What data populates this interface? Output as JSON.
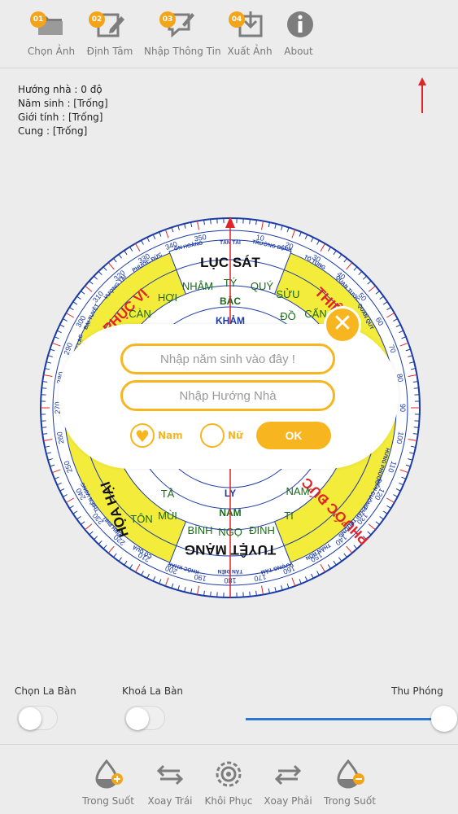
{
  "toolbar": {
    "items": [
      {
        "badge": "01",
        "label": "Chọn Ảnh"
      },
      {
        "badge": "02",
        "label": "Định Tâm"
      },
      {
        "badge": "03",
        "label": "Nhập Thông Tin"
      },
      {
        "badge": "04",
        "label": "Xuất Ảnh"
      },
      {
        "badge": "",
        "label": "About"
      }
    ]
  },
  "info": {
    "house_direction": "Hướng nhà : 0 độ",
    "birth_year": "Năm sinh : [Trống]",
    "gender": "Giới tính : [Trống]",
    "cung": "Cung : [Trống]"
  },
  "compass": {
    "heading_degree": 0,
    "degree_labels": [
      "350",
      "340",
      "330",
      "320",
      "310",
      "300",
      "290",
      "280",
      "270",
      "260",
      "250",
      "240",
      "230",
      "220",
      "210",
      "200",
      "190",
      "180",
      "170",
      "160",
      "150",
      "140",
      "130",
      "120",
      "110",
      "100",
      "90",
      "80",
      "70",
      "60",
      "50",
      "40",
      "30",
      "20",
      "10"
    ],
    "section_names": {
      "top": "LỤC SÁT",
      "left_upper": "PHỤC VỊ",
      "right_upper": "THIÊN",
      "left_lower": "HỌA HẠI",
      "right_lower": "PHƯỚC ĐỨC",
      "bottom": "TUYỆT MẠNG"
    },
    "sectors": {
      "top_left": "NHÂM",
      "top_mid": "TÝ",
      "top_right": "QUÝ",
      "trigram_top": "BẮC",
      "trigram_top2": "KHẢM",
      "upper_right": "SỬU",
      "upper_right2": "ĐỒ",
      "upper_right3": "CẤN",
      "upper_left": "HỢI",
      "upper_left2": "CÀN",
      "lower_left": "TÔN",
      "lower_left2": "MÙI",
      "lower_left3": "TÂ",
      "bottom_left": "BÍNH",
      "bottom_mid": "NGỌ",
      "bottom_right": "ĐINH",
      "trigram_bottom": "NAM",
      "trigram_bottom2": "LY",
      "lower_right": "TI",
      "lower_right2": "NAM"
    },
    "star_labels": {
      "s1": "TẤN TÀI",
      "s2": "TRƯỜNG BỆNH",
      "s3": "ÔN HOÀNG",
      "s4": "TỐ TỤNG",
      "s5": "QUAN TƯỚC",
      "s6": "QUAN QUÝ",
      "s7": "PHƯỚC ĐỨC",
      "s8": "VƯỢNG TÀI",
      "s9": "BẠI TUYỆT",
      "s10": "HOAN LẠC",
      "s11": "THIÊN VONG",
      "s12": "VINH PHÚ",
      "s13": "CÔ QUẢ",
      "s14": "KHỐC KHẤP",
      "s15": "TẤN ĐIỀN",
      "s16": "VƯỢNG TẤM",
      "s17": "THÂN HÔN",
      "s18": "PHÁP TRƯỜNG",
      "s19": "ĐIÊN CUỒNG",
      "s20": "HƯNG PHƯỚC"
    }
  },
  "dialog": {
    "birth_year_placeholder": "Nhập năm sinh vào đây !",
    "direction_placeholder": "Nhập Hướng Nhà",
    "male_label": "Nam",
    "female_label": "Nữ",
    "ok_label": "OK",
    "close_label": "✕",
    "male_checked": true
  },
  "controls": {
    "choose_compass": "Chọn La Bàn",
    "lock_compass": "Khoá La Bàn",
    "zoom": "Thu Phóng",
    "zoom_value": 1.0
  },
  "bottombar": {
    "items": [
      {
        "label": "Trong Suốt"
      },
      {
        "label": "Xoay Trái"
      },
      {
        "label": "Khôi Phục"
      },
      {
        "label": "Xoay Phải"
      },
      {
        "label": "Trong Suốt"
      }
    ]
  },
  "colors": {
    "accent": "#f7b61f",
    "compass_yellow": "#f4ec3a",
    "compass_blue": "#1a3aa8",
    "needle_red": "#e0242a",
    "slider_blue": "#2a76d2"
  }
}
